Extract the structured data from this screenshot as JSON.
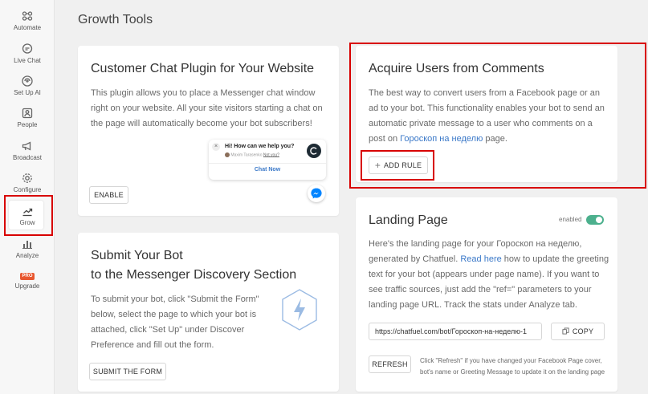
{
  "page_title": "Growth Tools",
  "sidebar": {
    "items": [
      {
        "label": "Automate",
        "icon": "automate-icon"
      },
      {
        "label": "Live Chat",
        "icon": "chat-bubble-icon"
      },
      {
        "label": "Set Up AI",
        "icon": "ai-icon"
      },
      {
        "label": "People",
        "icon": "people-icon"
      },
      {
        "label": "Broadcast",
        "icon": "megaphone-icon"
      },
      {
        "label": "Configure",
        "icon": "gear-icon"
      },
      {
        "label": "Grow",
        "icon": "grow-chart-icon"
      },
      {
        "label": "Analyze",
        "icon": "bar-chart-icon"
      },
      {
        "label": "Upgrade",
        "icon": "pro-badge-icon",
        "badge": "PRO"
      }
    ]
  },
  "chat_plugin": {
    "title": "Customer Chat Plugin for Your Website",
    "description": "This plugin allows you to place a Messenger chat window right on your website. All your site visitors starting a chat on the page will automatically become your bot subscribers!",
    "enable_label": "ENABLE",
    "preview": {
      "greeting": "Hi! How can we help you?",
      "subtext": "Maxim Tarasenko",
      "subtext_link": "Not you?",
      "chat_now": "Chat Now"
    }
  },
  "acquire_users": {
    "title": "Acquire Users from Comments",
    "description_before": "The best way to convert users from a Facebook page or an ad to your bot. This functionality enables your bot to send an automatic private message to a user who comments on a post on ",
    "page_link": "Гороскоп на неделю",
    "description_after": " page.",
    "add_rule_label": "ADD RULE"
  },
  "submit_bot": {
    "title_line1": "Submit Your Bot",
    "title_line2": "to the Messenger Discovery Section",
    "description": "To submit your bot, click \"Submit the Form\" below, select the page to which your bot is attached, click \"Set Up\" under Discover Preference and fill out the form.",
    "submit_label": "SUBMIT THE FORM"
  },
  "landing_page": {
    "title": "Landing Page",
    "status": "enabled",
    "enabled": true,
    "description_before": "Here's the landing page for your Гороскоп на неделю, generated by Chatfuel. ",
    "read_here": "Read here",
    "description_after": " how to update the greeting text for your bot (appears under page name). If you want to see traffic sources, just add the \"ref=\" parameters to your landing page URL. Track the stats under Analyze tab.",
    "url": "https://chatfuel.com/bot/Гороскоп-на-неделю-1",
    "copy_label": "COPY",
    "refresh_label": "REFRESH",
    "refresh_note": "Click \"Refresh\" if you have changed your Facebook Page cover, bot's name or Greeting Message to update it on the landing page"
  },
  "colors": {
    "highlight_red": "#d80000",
    "toggle_green": "#4cb08d",
    "link_blue": "#3a78c8",
    "messenger_blue": "#0084ff"
  }
}
